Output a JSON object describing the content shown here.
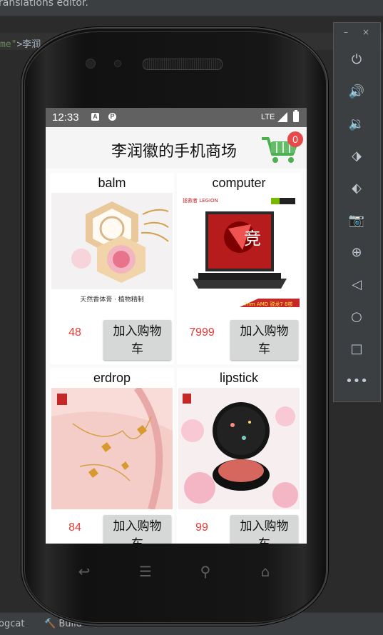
{
  "ide": {
    "top_text": "ranslations editor.",
    "code_attr": "me\"",
    "code_text": ">李润",
    "bottom_tabs": [
      "ogcat",
      "Build"
    ]
  },
  "status_bar": {
    "time": "12:33",
    "network": "LTE"
  },
  "app": {
    "title": "李润徽的手机商场",
    "cart_count": "0"
  },
  "products": [
    {
      "name": "balm",
      "price": "48",
      "button": "加入购物车"
    },
    {
      "name": "computer",
      "price": "7999",
      "button": "加入购物车"
    },
    {
      "name": "erdrop",
      "price": "84",
      "button": "加入购物车"
    },
    {
      "name": "lipstick",
      "price": "99",
      "button": "加入购物车"
    }
  ],
  "product_images": {
    "balm_caption": "天然香体膏 · 植物精制",
    "computer_brand": "拯救者 LEGION",
    "computer_ribbon": "7nm AMD 锐龙7 8核",
    "computer_poster_char": "竞"
  },
  "emulator": {
    "window_controls": [
      "–",
      "×"
    ],
    "buttons": [
      "power-icon",
      "volume-up-icon",
      "volume-down-icon",
      "rotate-left-icon",
      "rotate-right-icon",
      "camera-icon",
      "zoom-icon",
      "back-icon",
      "home-icon",
      "overview-icon",
      "more-icon"
    ]
  },
  "colors": {
    "price": "#e53935",
    "badge": "#e74a4a",
    "cart_green": "#4caf50",
    "button_bg": "#d6d7d7"
  }
}
